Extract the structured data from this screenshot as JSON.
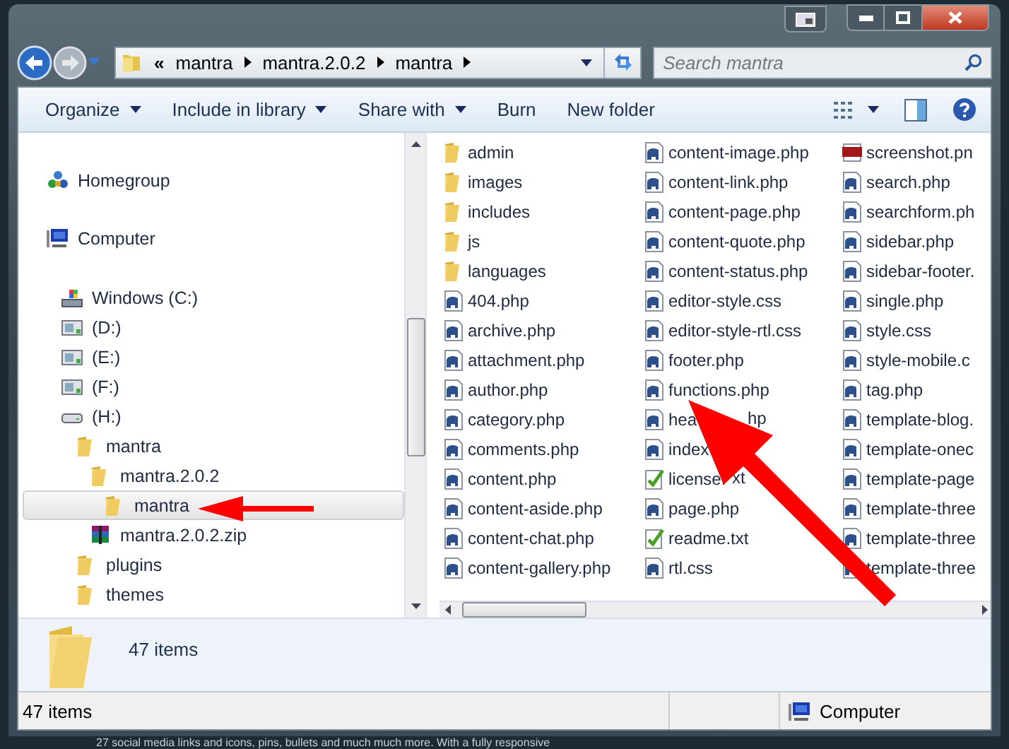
{
  "address": {
    "overflow_mark": "«",
    "crumbs": [
      "mantra",
      "mantra.2.0.2",
      "mantra"
    ]
  },
  "search": {
    "placeholder": "Search mantra"
  },
  "toolbar": [
    {
      "label": "Organize",
      "dropdown": true
    },
    {
      "label": "Include in library",
      "dropdown": true
    },
    {
      "label": "Share with",
      "dropdown": true
    },
    {
      "label": "Burn",
      "dropdown": false
    },
    {
      "label": "New folder",
      "dropdown": false
    }
  ],
  "navigation": [
    {
      "label": "Homegroup",
      "kind": "homegroup",
      "selected": false
    },
    {
      "label": "Computer",
      "kind": "computer",
      "selected": false,
      "children": [
        {
          "label": "Windows (C:)",
          "kind": "system-drive",
          "selected": false
        },
        {
          "label": "(D:)",
          "kind": "network-drive",
          "selected": false
        },
        {
          "label": "(E:)",
          "kind": "network-drive",
          "selected": false
        },
        {
          "label": "(F:)",
          "kind": "network-drive",
          "selected": false
        },
        {
          "label": "(H:)",
          "kind": "drive",
          "selected": false,
          "children": [
            {
              "label": "mantra",
              "kind": "folder",
              "selected": false,
              "children": [
                {
                  "label": "mantra.2.0.2",
                  "kind": "folder",
                  "selected": false,
                  "children": [
                    {
                      "label": "mantra",
                      "kind": "folder",
                      "selected": true
                    }
                  ]
                },
                {
                  "label": "mantra.2.0.2.zip",
                  "kind": "zip",
                  "selected": false
                }
              ]
            },
            {
              "label": "plugins",
              "kind": "folder",
              "selected": false
            },
            {
              "label": "themes",
              "kind": "folder",
              "selected": false
            }
          ]
        }
      ]
    }
  ],
  "files": [
    {
      "name": "admin",
      "kind": "folder"
    },
    {
      "name": "images",
      "kind": "folder"
    },
    {
      "name": "includes",
      "kind": "folder"
    },
    {
      "name": "js",
      "kind": "folder"
    },
    {
      "name": "languages",
      "kind": "folder"
    },
    {
      "name": "404.php",
      "kind": "script"
    },
    {
      "name": "archive.php",
      "kind": "script"
    },
    {
      "name": "attachment.php",
      "kind": "script"
    },
    {
      "name": "author.php",
      "kind": "script"
    },
    {
      "name": "category.php",
      "kind": "script"
    },
    {
      "name": "comments.php",
      "kind": "script"
    },
    {
      "name": "content.php",
      "kind": "script"
    },
    {
      "name": "content-aside.php",
      "kind": "script"
    },
    {
      "name": "content-chat.php",
      "kind": "script"
    },
    {
      "name": "content-gallery.php",
      "kind": "script"
    },
    {
      "name": "content-image.php",
      "kind": "script"
    },
    {
      "name": "content-link.php",
      "kind": "script"
    },
    {
      "name": "content-page.php",
      "kind": "script"
    },
    {
      "name": "content-quote.php",
      "kind": "script"
    },
    {
      "name": "content-status.php",
      "kind": "script"
    },
    {
      "name": "editor-style.css",
      "kind": "script"
    },
    {
      "name": "editor-style-rtl.css",
      "kind": "script"
    },
    {
      "name": "footer.php",
      "kind": "script"
    },
    {
      "name": "functions.php",
      "kind": "script"
    },
    {
      "name": "hea",
      "tail": "hp",
      "kind": "script"
    },
    {
      "name": "index",
      "kind": "script"
    },
    {
      "name": "license.",
      "tail": "xt",
      "kind": "text"
    },
    {
      "name": "page.php",
      "kind": "script"
    },
    {
      "name": "readme.txt",
      "kind": "text"
    },
    {
      "name": "rtl.css",
      "kind": "script"
    },
    {
      "name": "screenshot.pn",
      "kind": "image"
    },
    {
      "name": "search.php",
      "kind": "script"
    },
    {
      "name": "searchform.ph",
      "kind": "script"
    },
    {
      "name": "sidebar.php",
      "kind": "script"
    },
    {
      "name": "sidebar-footer.",
      "kind": "script"
    },
    {
      "name": "single.php",
      "kind": "script"
    },
    {
      "name": "style.css",
      "kind": "script"
    },
    {
      "name": "style-mobile.c",
      "kind": "script"
    },
    {
      "name": "tag.php",
      "kind": "script"
    },
    {
      "name": "template-blog.",
      "kind": "script"
    },
    {
      "name": "template-onec",
      "kind": "script"
    },
    {
      "name": "template-page",
      "kind": "script"
    },
    {
      "name": "template-three",
      "kind": "script"
    },
    {
      "name": "template-three",
      "kind": "script"
    },
    {
      "name": "template-three",
      "kind": "script"
    }
  ],
  "details": {
    "count": "47 items"
  },
  "status_bar": {
    "count": "47 items",
    "location": "Computer"
  },
  "annotations": {
    "tree_arrow": true,
    "file_arrow": true
  },
  "background_text": "27 social media links and icons, pins, bullets and much much more. With a fully responsive"
}
